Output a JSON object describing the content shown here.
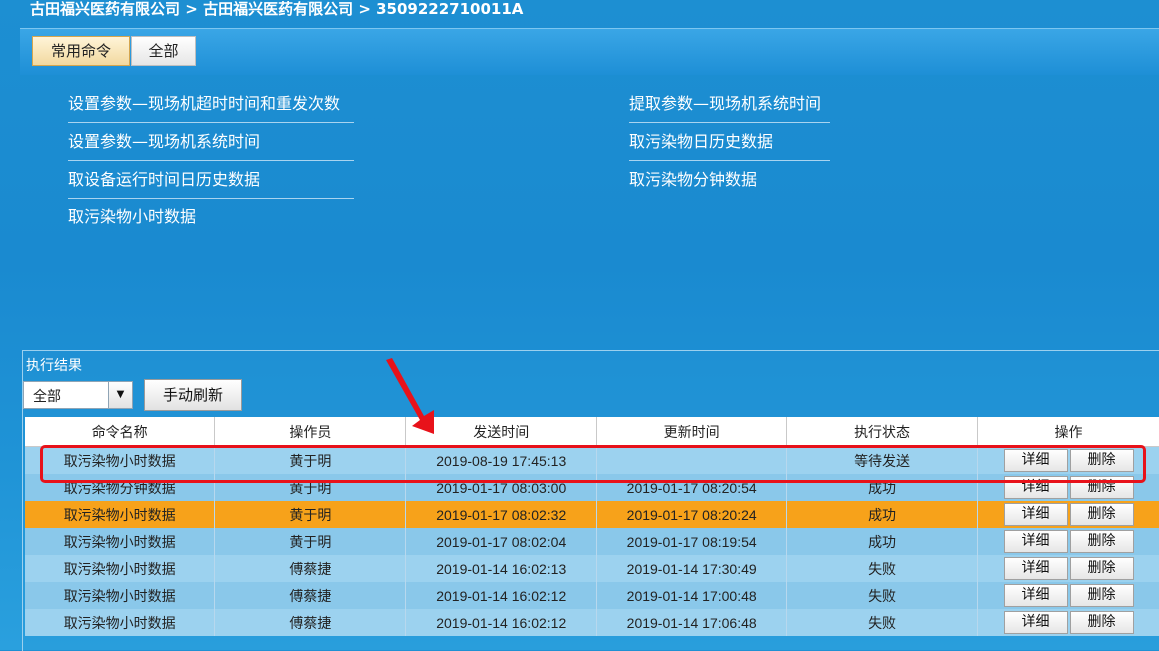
{
  "breadcrumb": {
    "level1": "古田福兴医药有限公司",
    "sep": ">",
    "level2": "古田福兴医药有限公司",
    "level3": "3509222710011A"
  },
  "tabs": [
    {
      "label": "常用命令",
      "active": true
    },
    {
      "label": "全部",
      "active": false
    }
  ],
  "commands_left": [
    "设置参数—现场机超时时间和重发次数",
    "设置参数—现场机系统时间",
    "取设备运行时间日历史数据",
    "取污染物小时数据"
  ],
  "commands_right": [
    "提取参数—现场机系统时间",
    "取污染物日历史数据",
    "取污染物分钟数据"
  ],
  "results": {
    "title": "执行结果",
    "filter_value": "全部",
    "refresh_label": "手动刷新",
    "columns": [
      "命令名称",
      "操作员",
      "发送时间",
      "更新时间",
      "执行状态",
      "操作"
    ],
    "detail_label": "详细",
    "delete_label": "删除",
    "rows": [
      {
        "name": "取污染物小时数据",
        "operator": "黄于明",
        "sent": "2019-08-19 17:45:13",
        "updated": "",
        "status": "等待发送"
      },
      {
        "name": "取污染物分钟数据",
        "operator": "黄于明",
        "sent": "2019-01-17 08:03:00",
        "updated": "2019-01-17 08:20:54",
        "status": "成功"
      },
      {
        "name": "取污染物小时数据",
        "operator": "黄于明",
        "sent": "2019-01-17 08:02:32",
        "updated": "2019-01-17 08:20:24",
        "status": "成功"
      },
      {
        "name": "取污染物小时数据",
        "operator": "黄于明",
        "sent": "2019-01-17 08:02:04",
        "updated": "2019-01-17 08:19:54",
        "status": "成功"
      },
      {
        "name": "取污染物小时数据",
        "operator": "傅蔡捷",
        "sent": "2019-01-14 16:02:13",
        "updated": "2019-01-14 17:30:49",
        "status": "失败"
      },
      {
        "name": "取污染物小时数据",
        "operator": "傅蔡捷",
        "sent": "2019-01-14 16:02:12",
        "updated": "2019-01-14 17:00:48",
        "status": "失败"
      },
      {
        "name": "取污染物小时数据",
        "operator": "傅蔡捷",
        "sent": "2019-01-14 16:02:12",
        "updated": "2019-01-14 17:06:48",
        "status": "失败"
      }
    ]
  },
  "colors": {
    "highlight_row": "#f7a21a",
    "annotation": "#e8121a"
  }
}
